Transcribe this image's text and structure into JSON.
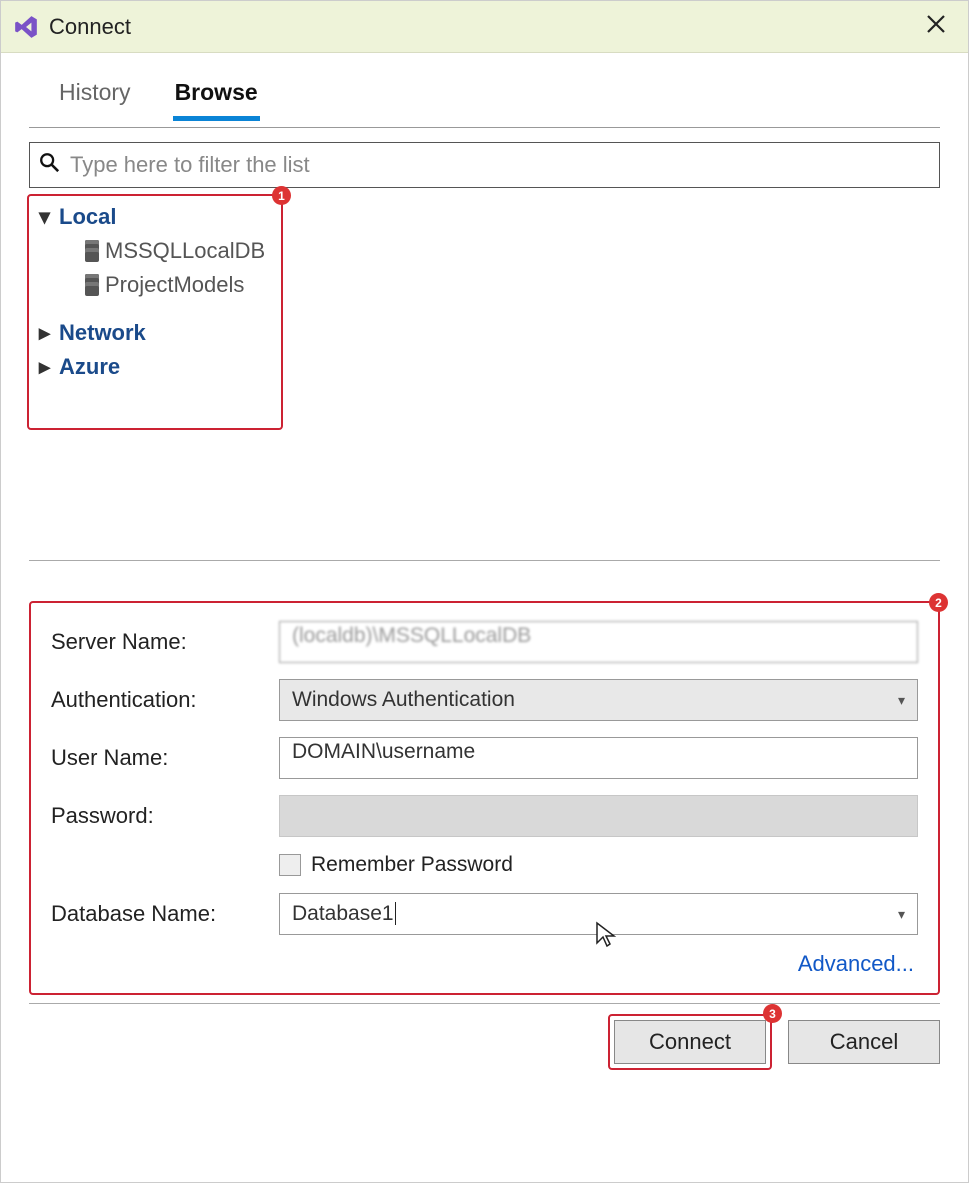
{
  "titlebar": {
    "title": "Connect"
  },
  "tabs": {
    "history": "History",
    "browse": "Browse"
  },
  "filter": {
    "placeholder": "Type here to filter the list"
  },
  "tree": {
    "local_label": "Local",
    "local_items": [
      "MSSQLLocalDB",
      "ProjectModels"
    ],
    "network_label": "Network",
    "azure_label": "Azure"
  },
  "form": {
    "server_name_label": "Server Name:",
    "server_name_value": "(localdb)\\MSSQLLocalDB",
    "auth_label": "Authentication:",
    "auth_value": "Windows Authentication",
    "user_label": "User Name:",
    "user_value": "DOMAIN\\username",
    "password_label": "Password:",
    "password_value": "",
    "remember_label": "Remember Password",
    "database_label": "Database Name:",
    "database_value": "Database1",
    "advanced_label": "Advanced..."
  },
  "footer": {
    "connect_label": "Connect",
    "cancel_label": "Cancel"
  },
  "annotations": {
    "b1": "1",
    "b2": "2",
    "b3": "3"
  }
}
